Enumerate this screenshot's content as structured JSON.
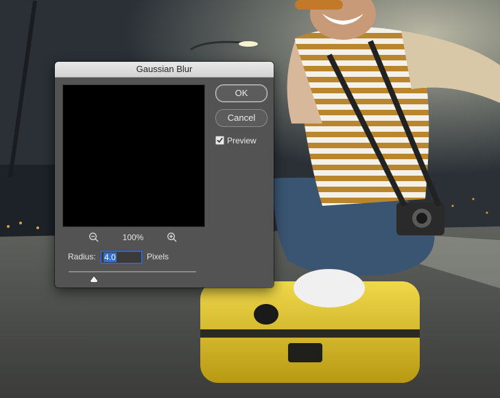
{
  "dialog": {
    "title": "Gaussian Blur",
    "zoom_level": "100%",
    "radius_label": "Radius:",
    "radius_value": "4.0",
    "radius_unit": "Pixels",
    "slider_fraction": 0.2,
    "buttons": {
      "ok": "OK",
      "cancel": "Cancel"
    },
    "preview": {
      "label": "Preview",
      "checked": true
    }
  },
  "icons": {
    "zoom_out": "zoom-out-icon",
    "zoom_in": "zoom-in-icon",
    "checkmark": "checkmark-icon",
    "slider_thumb": "slider-thumb-icon"
  },
  "colors": {
    "dialog_bg": "#535353",
    "titlebar": "#dcdcdc",
    "input_selection": "#2e6fd6",
    "suitcase": "#e3c925"
  }
}
